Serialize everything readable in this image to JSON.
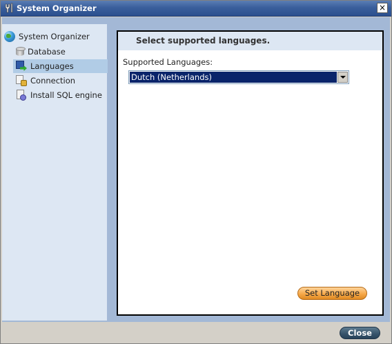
{
  "window": {
    "title": "System Organizer",
    "title_icon": "tools-icon",
    "close_glyph": "×"
  },
  "sidebar": {
    "root": {
      "label": "System Organizer",
      "icon": "globe-icon"
    },
    "items": [
      {
        "label": "Database",
        "icon": "database-icon",
        "selected": false
      },
      {
        "label": "Languages",
        "icon": "languages-icon",
        "selected": true
      },
      {
        "label": "Connection",
        "icon": "connection-icon",
        "selected": false
      },
      {
        "label": "Install SQL engine",
        "icon": "install-sql-icon",
        "selected": false
      }
    ]
  },
  "content": {
    "header": "Select supported languages.",
    "field_label": "Supported Languages:",
    "language_select": {
      "value": "Dutch (Netherlands)"
    },
    "set_language_button": "Set Language"
  },
  "footer": {
    "close_button": "Close"
  },
  "colors": {
    "titlebar": "#3a5f9c",
    "panel_bg": "#a3b8d6",
    "sidebar_bg": "#dde7f3",
    "selected_item": "#b1cce6",
    "select_highlight": "#0a246a",
    "set_language_button": "#f6a94a",
    "close_button": "#35526a"
  }
}
